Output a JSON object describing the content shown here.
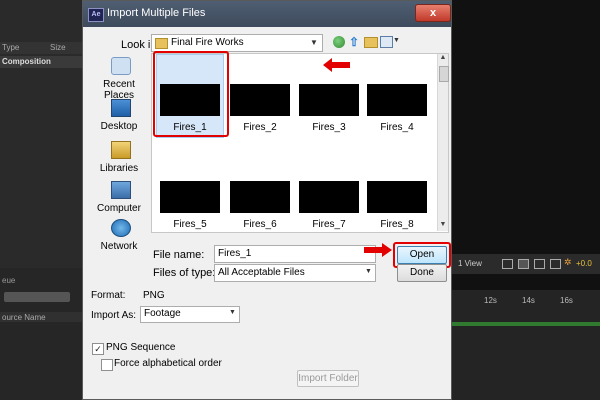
{
  "dialog": {
    "title": "Import Multiple Files",
    "app_badge": "Ae",
    "close_glyph": "x",
    "look_in_label": "Look in:",
    "look_in_value": "Final Fire Works",
    "places": [
      "Recent Places",
      "Desktop",
      "Libraries",
      "Computer",
      "Network"
    ],
    "files": [
      "Fires_1",
      "Fires_2",
      "Fires_3",
      "Fires_4",
      "Fires_5",
      "Fires_6",
      "Fires_7",
      "Fires_8"
    ],
    "selected_file": "Fires_1",
    "file_name_label": "File name:",
    "file_name_value": "Fires_1",
    "files_of_type_label": "Files of type:",
    "files_of_type_value": "All Acceptable Files",
    "open_label": "Open",
    "done_label": "Done",
    "format_label": "Format:",
    "format_value": "PNG",
    "import_as_label": "Import As:",
    "import_as_value": "Footage",
    "png_sequence_label": "PNG Sequence",
    "png_sequence_checked": true,
    "force_alpha_label": "Force alphabetical order",
    "force_alpha_checked": false,
    "import_folder_label": "Import Folder"
  },
  "background_app": {
    "col_type": "Type",
    "col_size": "Size",
    "composition_label": "Composition",
    "queue_label": "eue",
    "source_name_label": "ource Name",
    "view_label": "1 View",
    "plus_value": "+0.0",
    "ruler_ticks": [
      "12s",
      "14s",
      "16s"
    ]
  },
  "colors": {
    "annotation_red": "#e30000",
    "open_button": "#bee6fd",
    "selection_blue": "#d5e7f8"
  },
  "icons": {
    "back": "back-icon",
    "up": "up-folder-icon",
    "new_folder": "new-folder-icon",
    "views": "views-menu-icon"
  }
}
